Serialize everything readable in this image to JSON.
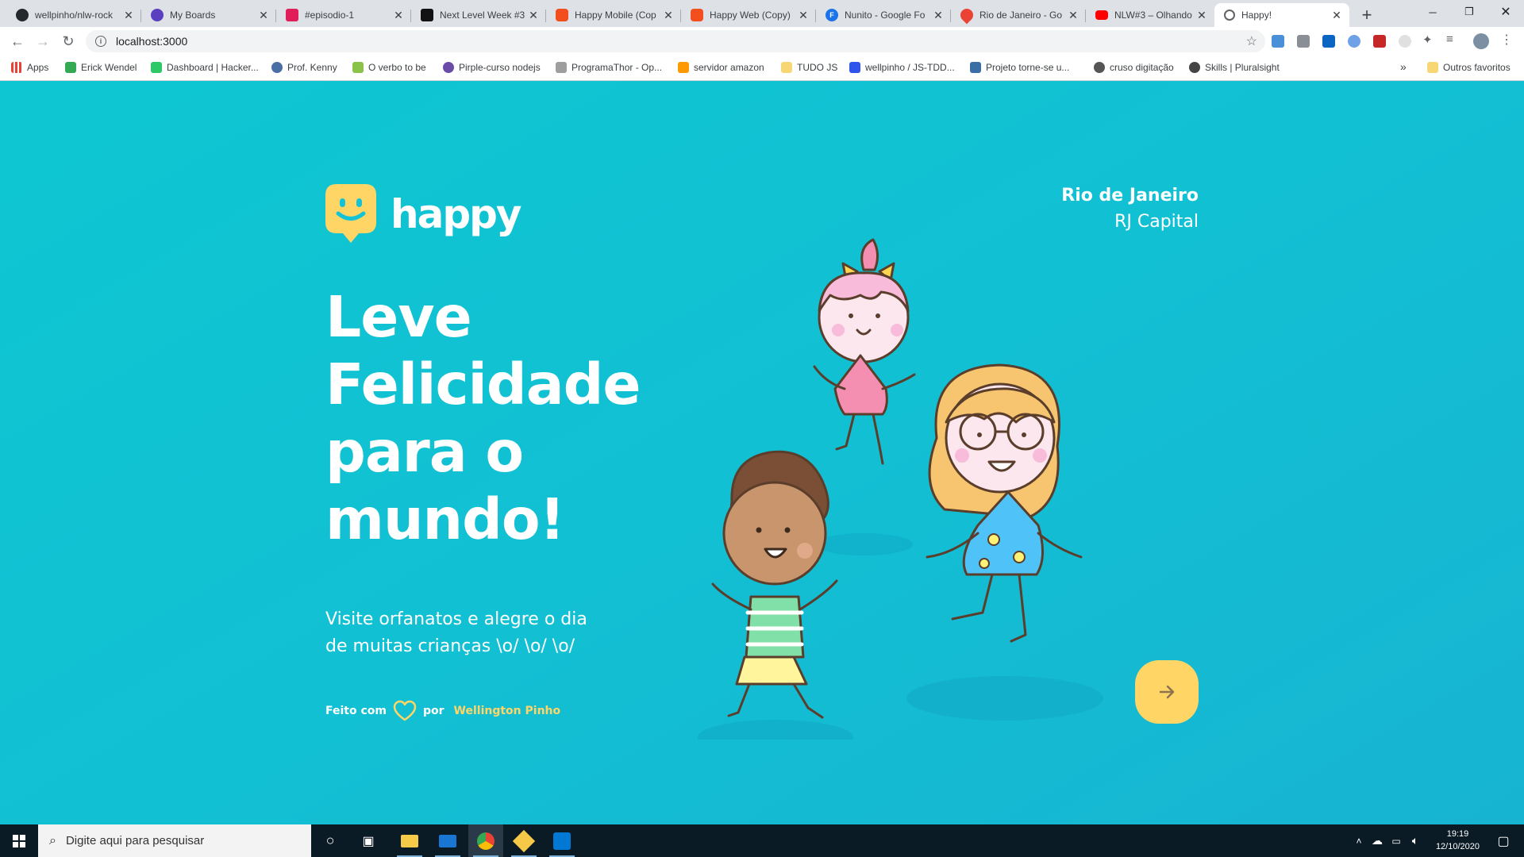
{
  "browser": {
    "tabs": [
      {
        "title": "wellpinho/nlw-rock",
        "fav_color": "#24292e",
        "fav_icon": "github-icon"
      },
      {
        "title": "My Boards",
        "fav_color": "#5a3fc0",
        "fav_icon": "whimsical-icon"
      },
      {
        "title": "#episodio-1",
        "fav_color": "#e01e5a",
        "fav_icon": "calendar-icon"
      },
      {
        "title": "Next Level Week #3",
        "fav_color": "#121214",
        "fav_icon": "rocketseat-icon"
      },
      {
        "title": "Happy Mobile (Cop",
        "fav_color": "#f24e1e",
        "fav_icon": "figma-icon"
      },
      {
        "title": "Happy Web (Copy)",
        "fav_color": "#f24e1e",
        "fav_icon": "figma-icon"
      },
      {
        "title": "Nunito - Google Fo",
        "fav_color": "#1a73e8",
        "fav_icon": "google-fonts-icon"
      },
      {
        "title": "Rio de Janeiro - Go",
        "fav_color": "#ea4335",
        "fav_icon": "maps-pin-icon"
      },
      {
        "title": "NLW#3 – Olhando",
        "fav_color": "#ff0000",
        "fav_icon": "youtube-icon"
      },
      {
        "title": "Happy!",
        "fav_color": "#5f6368",
        "fav_icon": "globe-icon"
      }
    ],
    "url": "localhost:3000",
    "bookmarks": [
      {
        "label": "Apps",
        "color": "#ea4335"
      },
      {
        "label": "Erick Wendel",
        "color": "#34a853"
      },
      {
        "label": "Dashboard | Hacker...",
        "color": "#2ec866"
      },
      {
        "label": "Prof. Kenny",
        "color": "#4a6fa5"
      },
      {
        "label": "O verbo to be",
        "color": "#8bc34a"
      },
      {
        "label": "Pirple-curso nodejs",
        "color": "#6a4ca7"
      },
      {
        "label": "ProgramaThor - Op...",
        "color": "#9e9e9e"
      },
      {
        "label": "servidor amazon",
        "color": "#ff9900"
      },
      {
        "label": "TUDO JS",
        "color": "#f7d774"
      },
      {
        "label": "wellpinho / JS-TDD...",
        "color": "#2f54eb"
      },
      {
        "label": "Projeto torne-se u...",
        "color": "#3b6ea5"
      },
      {
        "label": "cruso digitação",
        "color": "#555555"
      },
      {
        "label": "Skills | Pluralsight",
        "color": "#444444"
      }
    ],
    "other_bookmarks": "Outros favoritos",
    "more_bookmarks": "»"
  },
  "page": {
    "brand": "happy",
    "location": {
      "city": "Rio de Janeiro",
      "state": "RJ Capital"
    },
    "headline": "Leve Felicidade para o mundo!",
    "subtitle": "Visite orfanatos e alegre o dia de muitas crianças \\o/ \\o/ \\o/",
    "credit": {
      "made_with": "Feito com",
      "by": "por",
      "author": "Wellington Pinho"
    },
    "colors": {
      "accent": "#ffd666",
      "background": "#15c3d6",
      "heart": "#ffd666"
    }
  },
  "taskbar": {
    "search_placeholder": "Digite aqui para pesquisar",
    "time": "19:19",
    "date": "12/10/2020"
  }
}
